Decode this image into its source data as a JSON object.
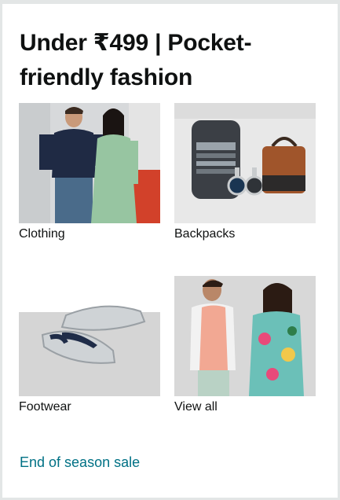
{
  "card": {
    "title": "Under ₹499 | Pocket-friendly fashion",
    "tiles": [
      {
        "label": "Clothing",
        "image": "clothing-image"
      },
      {
        "label": "Backpacks",
        "image": "backpacks-image"
      },
      {
        "label": "Footwear",
        "image": "footwear-image"
      },
      {
        "label": "View all",
        "image": "view-all-image"
      }
    ],
    "footer_link": "End of season sale"
  },
  "colors": {
    "background": "#e3e6e6",
    "card": "#ffffff",
    "text": "#0f1111",
    "link": "#007185"
  }
}
